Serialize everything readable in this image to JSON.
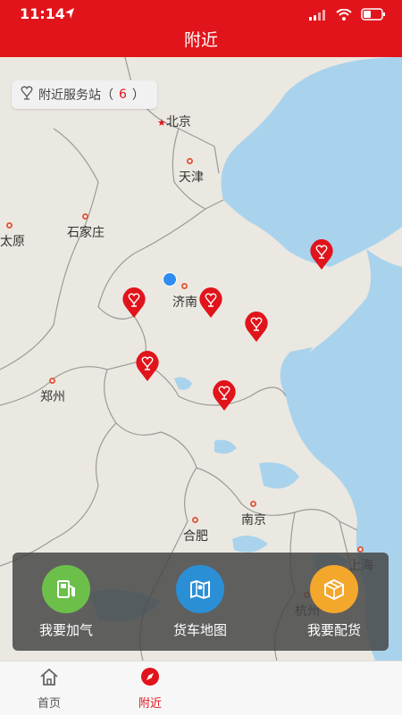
{
  "status": {
    "time": "11:14"
  },
  "nav": {
    "title": "附近"
  },
  "map": {
    "station_label": "附近服务站（",
    "station_count": "6",
    "station_suffix": "）",
    "cities": {
      "beijing": "北京",
      "tianjin": "天津",
      "shijiazhuang": "石家庄",
      "taiyuan": "太原",
      "jinan": "济南",
      "zhengzhou": "郑州",
      "hefei": "合肥",
      "nanjing": "南京",
      "shanghai": "上海",
      "hangzhou": "杭州"
    }
  },
  "actions": [
    {
      "label": "我要加气",
      "icon": "gas-pump-icon",
      "color": "#6cc04a"
    },
    {
      "label": "货车地图",
      "icon": "map-icon",
      "color": "#2b8fd6"
    },
    {
      "label": "我要配货",
      "icon": "box-icon",
      "color": "#f3a72b"
    }
  ],
  "tabs": [
    {
      "label": "首页",
      "icon": "home-icon"
    },
    {
      "label": "附近",
      "icon": "compass-icon"
    }
  ],
  "colors": {
    "brand": "#e1141b",
    "water": "#a9d3ec",
    "land": "#ebe8e1"
  }
}
